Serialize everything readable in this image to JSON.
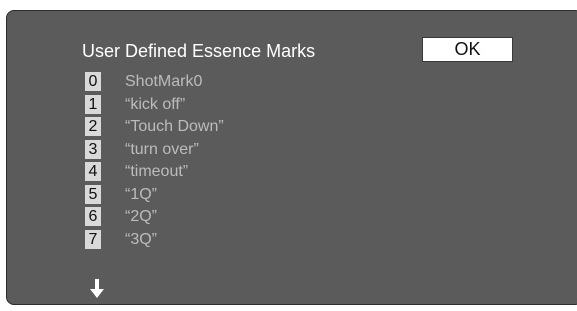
{
  "dialog": {
    "title": "User Defined Essence Marks",
    "ok_label": "OK"
  },
  "items": [
    {
      "number": "0",
      "label": "ShotMark0"
    },
    {
      "number": "1",
      "label": "“kick off”"
    },
    {
      "number": "2",
      "label": "“Touch Down”"
    },
    {
      "number": "3",
      "label": "“turn over”"
    },
    {
      "number": "4",
      "label": "“timeout”"
    },
    {
      "number": "5",
      "label": "“1Q”"
    },
    {
      "number": "6",
      "label": "“2Q”"
    },
    {
      "number": "7",
      "label": "“3Q”"
    }
  ],
  "scroll_indicator": {
    "icon": "arrow-down-icon"
  },
  "colors": {
    "screen_background": "#5b5b5b",
    "title_text": "#ffffff",
    "item_text": "#bcbcbc",
    "number_badge": "#d9d9d9"
  }
}
